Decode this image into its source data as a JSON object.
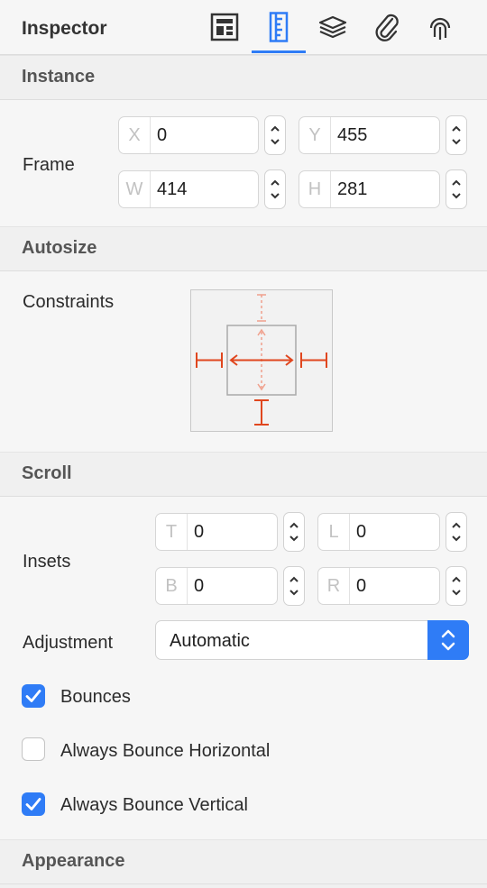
{
  "header": {
    "title": "Inspector",
    "tabs": [
      {
        "name": "layout-tab"
      },
      {
        "name": "ruler-tab",
        "selected": true
      },
      {
        "name": "layers-tab"
      },
      {
        "name": "attachment-tab"
      },
      {
        "name": "touch-tab"
      }
    ],
    "accent_color": "#2f7cf6"
  },
  "sections": {
    "instance": "Instance",
    "autosize": "Autosize",
    "scroll": "Scroll",
    "appearance": "Appearance"
  },
  "frame": {
    "label": "Frame",
    "x": {
      "prefix": "X",
      "value": "0"
    },
    "y": {
      "prefix": "Y",
      "value": "455"
    },
    "w": {
      "prefix": "W",
      "value": "414"
    },
    "h": {
      "prefix": "H",
      "value": "281"
    }
  },
  "constraints": {
    "label": "Constraints",
    "constraint_color": "#e0461e"
  },
  "insets": {
    "label": "Insets",
    "t": {
      "prefix": "T",
      "value": "0"
    },
    "l": {
      "prefix": "L",
      "value": "0"
    },
    "b": {
      "prefix": "B",
      "value": "0"
    },
    "r": {
      "prefix": "R",
      "value": "0"
    }
  },
  "adjustment": {
    "label": "Adjustment",
    "value": "Automatic"
  },
  "checkboxes": {
    "bounces": {
      "label": "Bounces",
      "checked": true
    },
    "always_bounce_horizontal": {
      "label": "Always Bounce Horizontal",
      "checked": false
    },
    "always_bounce_vertical": {
      "label": "Always Bounce Vertical",
      "checked": true
    }
  }
}
